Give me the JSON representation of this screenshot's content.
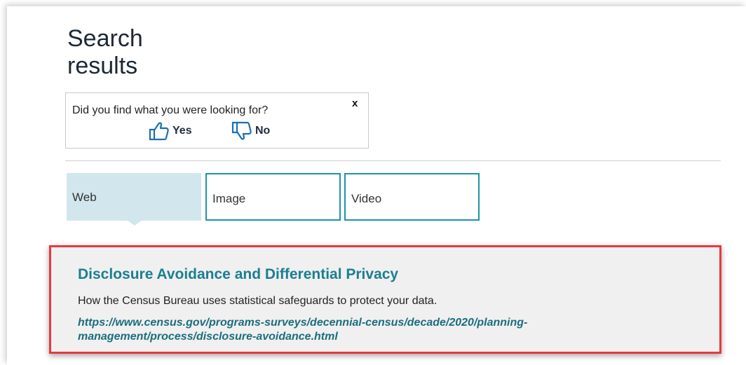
{
  "page": {
    "title": "Search results"
  },
  "feedback": {
    "question": "Did you find what you were looking for?",
    "close_label": "x",
    "yes_label": "Yes",
    "no_label": "No"
  },
  "tabs": [
    {
      "label": "Web",
      "selected": true
    },
    {
      "label": "Image",
      "selected": false
    },
    {
      "label": "Video",
      "selected": false
    }
  ],
  "results": [
    {
      "title": "Disclosure Avoidance and Differential Privacy",
      "description": "How the Census Bureau uses statistical safeguards to protect your data.",
      "url": "https://www.census.gov/programs-surveys/decennial-census/decade/2020/planning-management/process/disclosure-avoidance.html"
    }
  ],
  "colors": {
    "accent": "#1a95a6",
    "link": "#1b7f91",
    "selected_tab_bg": "#d1e7ed",
    "highlight_border": "#e8383d"
  }
}
